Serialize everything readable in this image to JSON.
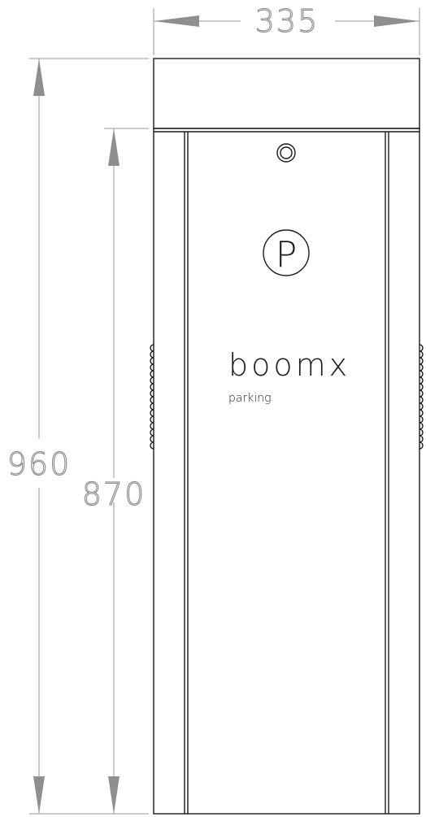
{
  "drawing": {
    "dimensions": {
      "width": "335",
      "total_height": "960",
      "body_height": "870"
    },
    "brand": {
      "logo_letter": "P",
      "name": "boomx",
      "tagline": "parking"
    },
    "colors": {
      "outline": "#1a1a1a",
      "dimension": "#8a8a8a",
      "background": "#ffffff"
    }
  }
}
